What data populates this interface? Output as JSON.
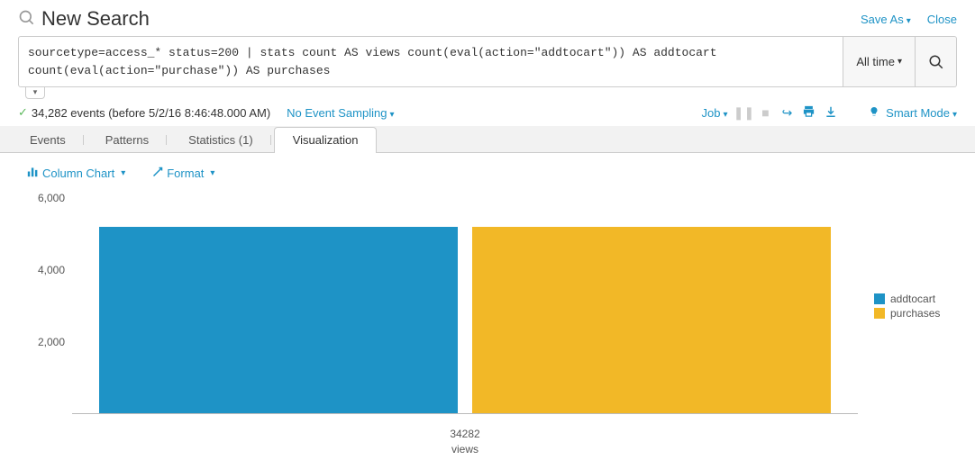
{
  "header": {
    "title": "New Search",
    "save_as": "Save As",
    "close": "Close"
  },
  "search": {
    "query": "sourcetype=access_* status=200 | stats count AS views count(eval(action=\"addtocart\")) AS addtocart count(eval(action=\"purchase\")) AS purchases",
    "time_label": "All time"
  },
  "status": {
    "events_text": "34,282 events (before 5/2/16 8:46:48.000 AM)",
    "sampling": "No Event Sampling",
    "job": "Job",
    "smart_mode": "Smart Mode"
  },
  "tabs": {
    "events": "Events",
    "patterns": "Patterns",
    "statistics": "Statistics (1)",
    "visualization": "Visualization"
  },
  "viz_toolbar": {
    "chart_type": "Column Chart",
    "format": "Format"
  },
  "legend": {
    "addtocart": "addtocart",
    "purchases": "purchases"
  },
  "xaxis": {
    "value": "34282",
    "label": "views"
  },
  "yaxis": {
    "t6000": "6,000",
    "t4000": "4,000",
    "t2000": "2,000"
  },
  "chart_data": {
    "type": "bar",
    "categories": [
      "34282"
    ],
    "series": [
      {
        "name": "addtocart",
        "values": [
          5200
        ],
        "color": "#1e93c6"
      },
      {
        "name": "purchases",
        "values": [
          5200
        ],
        "color": "#f2b827"
      }
    ],
    "title": "",
    "xlabel": "views",
    "ylabel": "",
    "ylim": [
      0,
      6000
    ],
    "yticks": [
      2000,
      4000,
      6000
    ]
  }
}
